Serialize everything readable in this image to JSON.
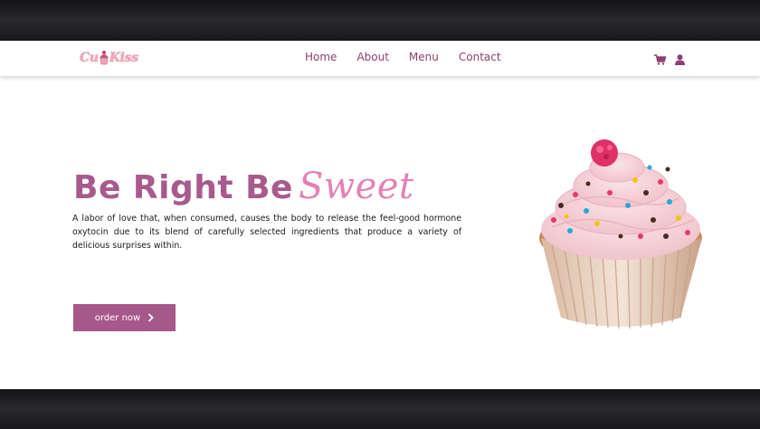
{
  "brand": {
    "logo_text": "CupKiss"
  },
  "nav": {
    "links": [
      "Home",
      "About",
      "Menu",
      "Contact"
    ],
    "icons": [
      "cart-icon",
      "user-icon"
    ]
  },
  "hero": {
    "title_main": "Be Right Be",
    "title_accent": "Sweet",
    "description": "A labor of love that, when consumed, causes the body to release the feel-good hormone oxytocin due to its blend of carefully selected ingredients that produce a variety of delicious surprises within.",
    "cta_label": "order now",
    "cta_icon": "chevron-right-icon",
    "image": "cupcake-image"
  },
  "colors": {
    "accent": "#a55889",
    "title": "#a85a8e",
    "title_accent": "#e67fb5",
    "nav_text": "#8e3f72"
  }
}
